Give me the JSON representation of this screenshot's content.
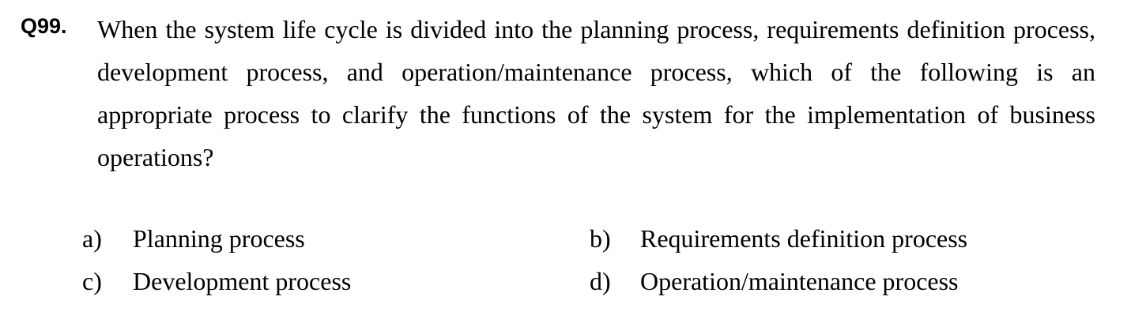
{
  "question": {
    "number": "Q99.",
    "text": "When the system life cycle is divided into the planning process, requirements definition process, development process, and operation/maintenance process, which of the following is an appropriate process to clarify the functions of the system for the implementation of business operations?"
  },
  "options": [
    {
      "letter": "a)",
      "text": "Planning process"
    },
    {
      "letter": "b)",
      "text": "Requirements definition process"
    },
    {
      "letter": "c)",
      "text": "Development process"
    },
    {
      "letter": "d)",
      "text": "Operation/maintenance process"
    }
  ]
}
